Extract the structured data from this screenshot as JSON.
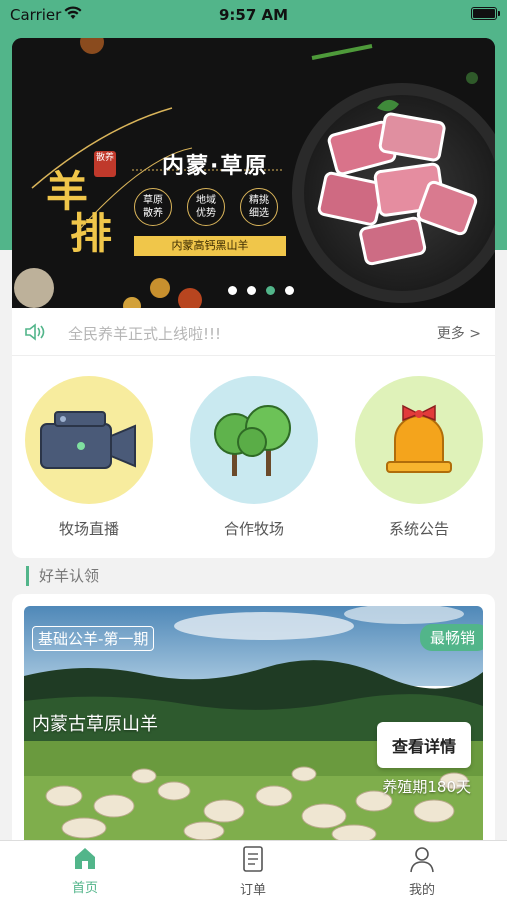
{
  "status_bar": {
    "carrier": "Carrier",
    "time": "9:57 AM"
  },
  "banner": {
    "heading": "内蒙·草原",
    "big_char_1": "羊",
    "big_char_2": "排",
    "tag": "散养",
    "badges": [
      "草原\n散养",
      "地域\n优势",
      "精挑\n细选"
    ],
    "ribbon": "内蒙高钙黑山羊",
    "slide_count": 4,
    "active_slide": 3
  },
  "notice": {
    "text": "全民养羊正式上线啦!!!",
    "more": "更多 >"
  },
  "features": [
    {
      "label": "牧场直播",
      "icon": "video-camera-icon",
      "color": "#f7ec9e"
    },
    {
      "label": "合作牧场",
      "icon": "trees-icon",
      "color": "#c9e9f0"
    },
    {
      "label": "系统公告",
      "icon": "bell-icon",
      "color": "#dff2b9"
    }
  ],
  "section": {
    "title": "好羊认领"
  },
  "product": {
    "name": "基础公羊-第一期",
    "badge": "最畅销",
    "farm": "内蒙古草原山羊",
    "detail_button": "查看详情",
    "period": "养殖期180天"
  },
  "tabbar": {
    "items": [
      {
        "label": "首页",
        "icon": "home-icon",
        "active": true
      },
      {
        "label": "订单",
        "icon": "order-icon",
        "active": false
      },
      {
        "label": "我的",
        "icon": "user-icon",
        "active": false
      }
    ]
  },
  "colors": {
    "accent": "#52b58a",
    "gold": "#f0c64a"
  }
}
